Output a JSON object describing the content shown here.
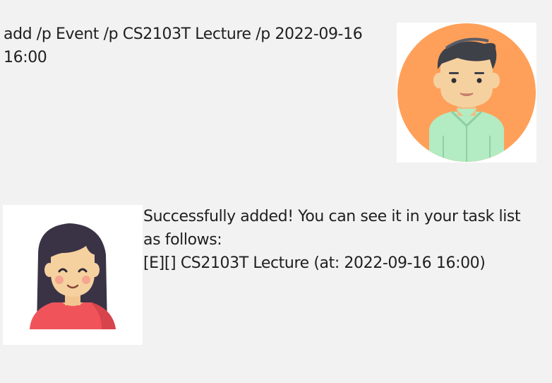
{
  "chat": {
    "user_message": "add /p Event /p CS2103T Lecture /p 2022-09-16 16:00",
    "bot_message_lines": [
      "Successfully added! You can see it in your task list",
      "as follows:",
      "[E][] CS2103T Lecture (at: 2022-09-16 16:00)"
    ],
    "user_avatar_icon": "man-avatar-icon",
    "bot_avatar_icon": "woman-avatar-icon"
  },
  "colors": {
    "background": "#f2f2f2",
    "user_avatar_circle": "#ffa05a",
    "user_shirt": "#b3ebc2",
    "bot_shirt": "#f0545a",
    "hair": "#3a3346",
    "skin": "#f6d1a0"
  }
}
